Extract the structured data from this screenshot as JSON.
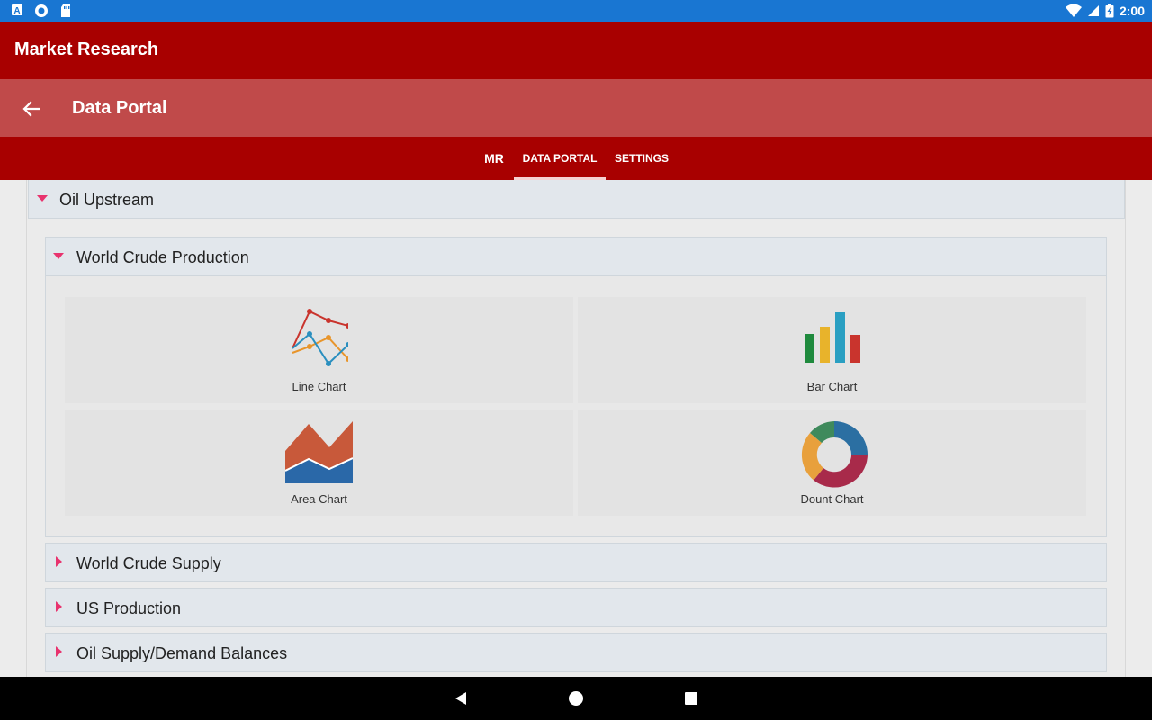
{
  "status_bar": {
    "time": "2:00"
  },
  "app_bar": {
    "title": "Market Research"
  },
  "sub_bar": {
    "title": "Data Portal"
  },
  "tabs": [
    {
      "label": "MR",
      "active": false
    },
    {
      "label": "DATA PORTAL",
      "active": true
    },
    {
      "label": "SETTINGS",
      "active": false
    }
  ],
  "outer_section": {
    "title": "Oil Upstream",
    "expanded": true
  },
  "inner_section": {
    "title": "World Crude Production",
    "expanded": true,
    "tiles": [
      {
        "label": "Line Chart",
        "icon": "line-chart-icon"
      },
      {
        "label": "Bar Chart",
        "icon": "bar-chart-icon"
      },
      {
        "label": "Area Chart",
        "icon": "area-chart-icon"
      },
      {
        "label": "Dount Chart",
        "icon": "donut-chart-icon"
      }
    ]
  },
  "collapsed_sections": [
    {
      "title": "World Crude Supply"
    },
    {
      "title": "US Production"
    },
    {
      "title": "Oil Supply/Demand Balances"
    }
  ],
  "colors": {
    "status_bar": "#1976d2",
    "app_bar": "#a80000",
    "sub_bar": "#c04a4a",
    "caret": "#e8336e",
    "section_header": "#e2e7ec"
  }
}
